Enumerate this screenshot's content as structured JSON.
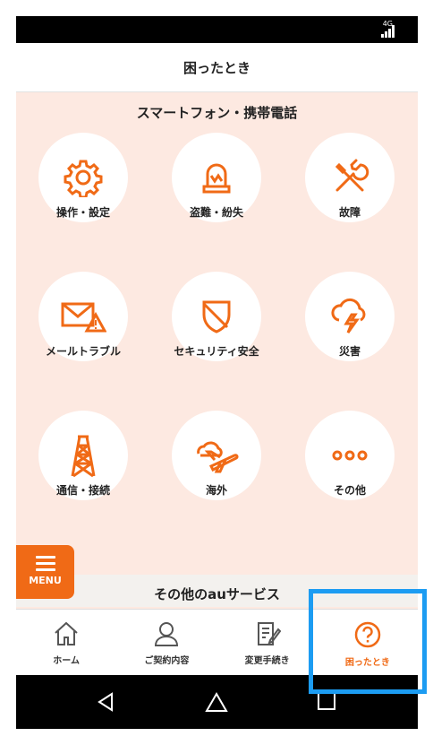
{
  "status_bar": {
    "network": "4G"
  },
  "header": {
    "title": "困ったとき"
  },
  "section": {
    "title": "スマートフォン・携帯電話",
    "items": [
      {
        "label": "操作・設定",
        "icon": "gear-icon"
      },
      {
        "label": "盗難・紛失",
        "icon": "siren-icon"
      },
      {
        "label": "故障",
        "icon": "tools-icon"
      },
      {
        "label": "メールトラブル",
        "icon": "mail-warning-icon"
      },
      {
        "label": "セキュリティ安全",
        "icon": "shield-icon"
      },
      {
        "label": "災害",
        "icon": "storm-icon"
      },
      {
        "label": "通信・接続",
        "icon": "antenna-tower-icon"
      },
      {
        "label": "海外",
        "icon": "airplane-icon"
      },
      {
        "label": "その他",
        "icon": "more-icon"
      }
    ]
  },
  "menu": {
    "label": "MENU"
  },
  "other_section": {
    "title": "その他のauサービス"
  },
  "tabs": [
    {
      "label": "ホーム",
      "icon": "home-icon",
      "active": false
    },
    {
      "label": "ご契約内容",
      "icon": "person-icon",
      "active": false
    },
    {
      "label": "変更手続き",
      "icon": "edit-document-icon",
      "active": false
    },
    {
      "label": "困ったとき",
      "icon": "help-icon",
      "active": true
    }
  ],
  "colors": {
    "accent": "#f06a16",
    "highlight": "#1c9cf2",
    "section_bg": "#fde9e1"
  }
}
